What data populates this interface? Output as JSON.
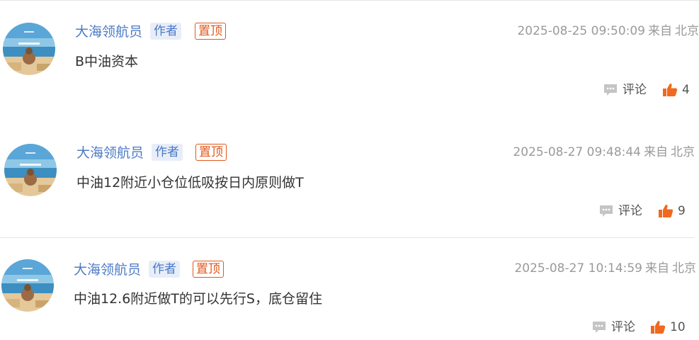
{
  "comments": [
    {
      "username": "大海领航员",
      "author_badge": "作者",
      "pinned_badge": "置顶",
      "timestamp": "2025-08-25 09:50:09",
      "source_prefix": "来自",
      "location": "北京",
      "content": "B中油资本",
      "comment_label": "评论",
      "like_count": "4"
    },
    {
      "username": "大海领航员",
      "author_badge": "作者",
      "pinned_badge": "置顶",
      "timestamp": "2025-08-27 09:48:44",
      "source_prefix": "来自",
      "location": "北京",
      "content": "中油12附近小仓位低吸按日内原则做T",
      "comment_label": "评论",
      "like_count": "9"
    },
    {
      "username": "大海领航员",
      "author_badge": "作者",
      "pinned_badge": "置顶",
      "timestamp": "2025-08-27 10:14:59",
      "source_prefix": "来自",
      "location": "北京",
      "content": "中油12.6附近做T的可以先行S，底仓留住",
      "comment_label": "评论",
      "like_count": "10"
    }
  ],
  "colors": {
    "username": "#4d7bc6",
    "pinned": "#e0581c",
    "like": "#f0691f",
    "meta": "#9a9a9a"
  },
  "icons": {
    "comment": "speech-bubble-icon",
    "like": "thumbs-up-icon"
  }
}
